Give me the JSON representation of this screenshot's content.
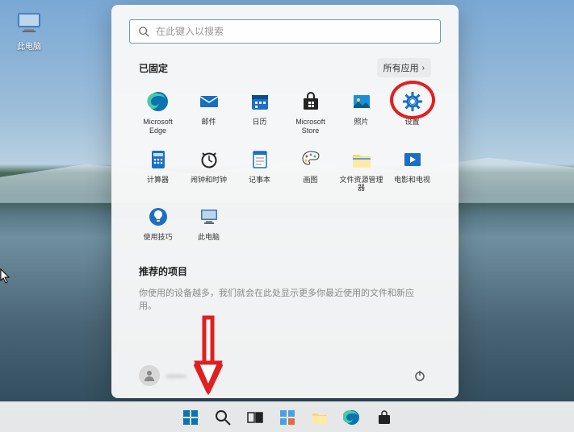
{
  "desktop": {
    "icon_label": "此电脑"
  },
  "start": {
    "search_placeholder": "在此键入以搜索",
    "pinned_title": "已固定",
    "all_apps_label": "所有应用",
    "apps": [
      {
        "id": "edge",
        "label": "Microsoft Edge"
      },
      {
        "id": "mail",
        "label": "邮件"
      },
      {
        "id": "calendar",
        "label": "日历"
      },
      {
        "id": "store",
        "label": "Microsoft Store"
      },
      {
        "id": "photos",
        "label": "照片"
      },
      {
        "id": "settings",
        "label": "设置",
        "highlight": true
      },
      {
        "id": "calculator",
        "label": "计算器"
      },
      {
        "id": "alarms",
        "label": "闹钟和时钟"
      },
      {
        "id": "notepad",
        "label": "记事本"
      },
      {
        "id": "paint",
        "label": "画图"
      },
      {
        "id": "explorer",
        "label": "文件资源管理器"
      },
      {
        "id": "movies",
        "label": "电影和电视"
      },
      {
        "id": "tips",
        "label": "使用技巧"
      },
      {
        "id": "thispc",
        "label": "此电脑"
      }
    ],
    "recommended_title": "推荐的项目",
    "recommended_hint": "你使用的设备越多，我们就会在此处显示更多你最近使用的文件和新应用。",
    "user_name": "——"
  },
  "taskbar": {
    "items": [
      {
        "id": "start",
        "name": "start-button"
      },
      {
        "id": "search",
        "name": "search-button"
      },
      {
        "id": "taskview",
        "name": "taskview-button"
      },
      {
        "id": "widgets",
        "name": "widgets-button"
      },
      {
        "id": "explorer",
        "name": "explorer-button"
      },
      {
        "id": "edge",
        "name": "edge-button"
      },
      {
        "id": "store",
        "name": "store-button"
      }
    ]
  },
  "colors": {
    "annotation": "#e02020",
    "accent": "#0a74b3"
  }
}
